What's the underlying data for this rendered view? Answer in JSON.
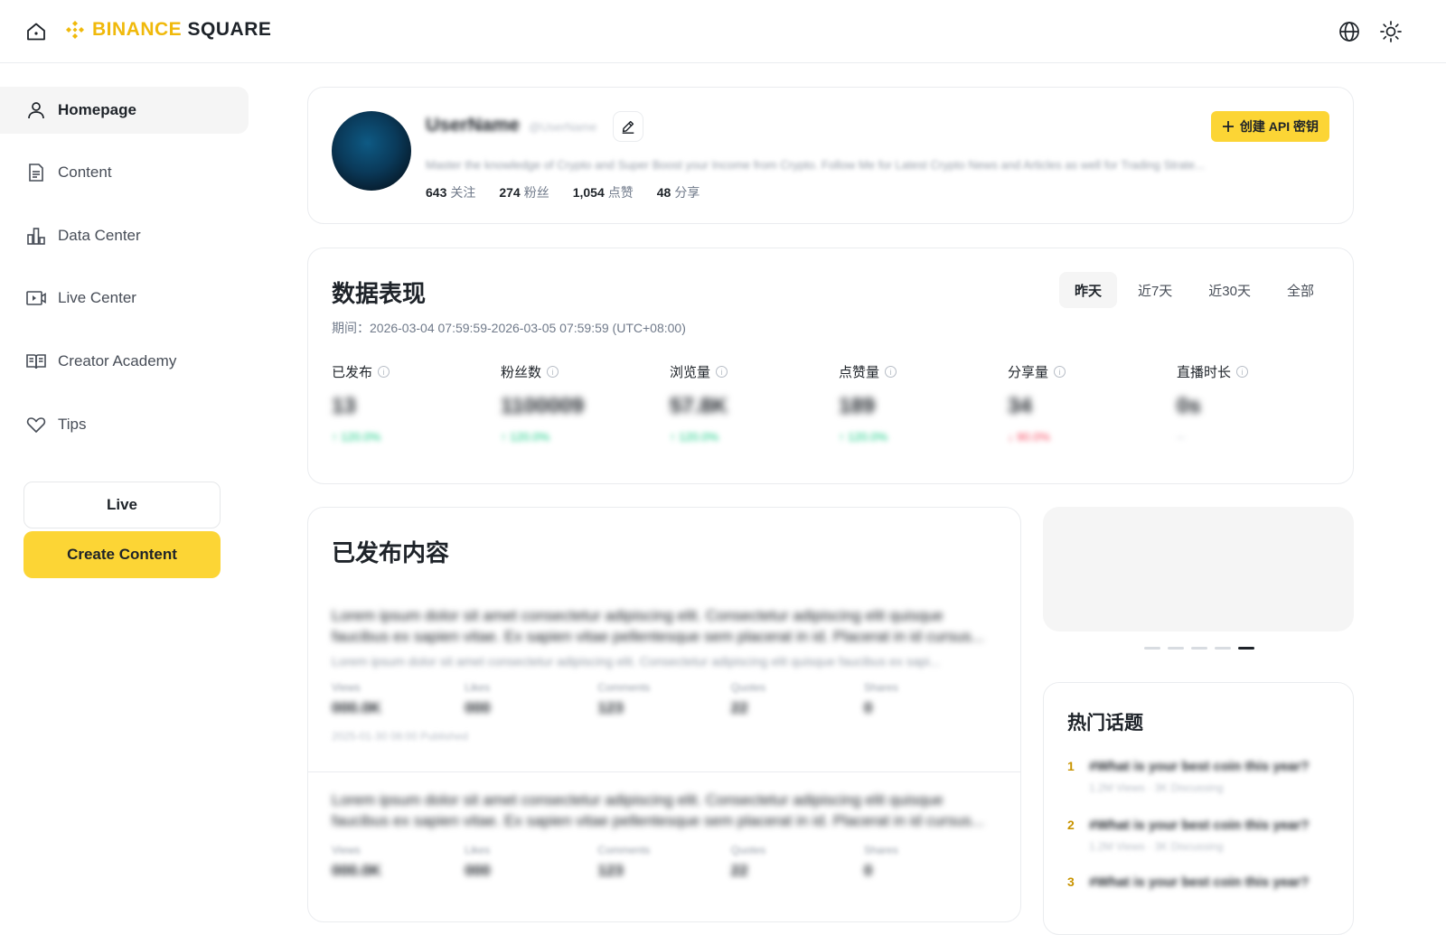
{
  "header": {
    "brand_part1": "BINANCE",
    "brand_part2": "SQUARE",
    "icons": [
      "home-icon",
      "globe-icon",
      "sun-icon"
    ],
    "brand_color": "#f0b90b"
  },
  "sidebar": {
    "items": [
      {
        "label": "Homepage",
        "icon": "user-icon",
        "active": true
      },
      {
        "label": "Content",
        "icon": "document-icon"
      },
      {
        "label": "Data Center",
        "icon": "bar-chart-icon"
      },
      {
        "label": "Live Center",
        "icon": "video-icon"
      },
      {
        "label": "Creator Academy",
        "icon": "book-icon"
      },
      {
        "label": "Tips",
        "icon": "heart-icon"
      }
    ],
    "live_label": "Live",
    "create_label": "Create Content"
  },
  "profile": {
    "username": "UserName",
    "handle": "@UserName",
    "bio": "Master the knowledge of Crypto and Super Boost your Income from Crypto. Follow Me for Latest Crypto News and Articles as well for Trading Strate...",
    "stats": [
      {
        "num": "643",
        "label": "关注"
      },
      {
        "num": "274",
        "label": "粉丝"
      },
      {
        "num": "1,054",
        "label": "点赞"
      },
      {
        "num": "48",
        "label": "分享"
      }
    ],
    "api_button": "创建 API 密钥"
  },
  "performance": {
    "title": "数据表现",
    "period": "期间：2026-03-04 07:59:59-2026-03-05 07:59:59 (UTC+08:00)",
    "tabs": [
      {
        "label": "昨天",
        "active": true
      },
      {
        "label": "近7天"
      },
      {
        "label": "近30天"
      },
      {
        "label": "全部"
      }
    ],
    "metrics": [
      {
        "label": "已发布",
        "value": "13",
        "change": "↑ 120.0%",
        "trend": "up"
      },
      {
        "label": "粉丝数",
        "value": "1100009",
        "change": "↑ 120.0%",
        "trend": "up"
      },
      {
        "label": "浏览量",
        "value": "57.8K",
        "change": "↑ 120.0%",
        "trend": "up"
      },
      {
        "label": "点赞量",
        "value": "189",
        "change": "↑ 120.0%",
        "trend": "up"
      },
      {
        "label": "分享量",
        "value": "34",
        "change": "↓ 90.0%",
        "trend": "down"
      },
      {
        "label": "直播时长",
        "value": "0s",
        "change": "--",
        "trend": "flat"
      }
    ]
  },
  "published": {
    "title": "已发布内容",
    "posts": [
      {
        "text": "Lorem ipsum dolor sit amet consectetur adipiscing elit. Consectetur adipiscing elit quisque faucibus ex sapien vitae. Ex sapien vitae pellentesque sem placerat in id. Placerat in id cursus...",
        "sub": "Lorem ipsum dolor sit amet consectetur adipiscing elit. Consectetur adipiscing elit quisque faucibus ex sapi...",
        "stats": [
          {
            "label": "Views",
            "value": "000.0K"
          },
          {
            "label": "Likes",
            "value": "000"
          },
          {
            "label": "Comments",
            "value": "123"
          },
          {
            "label": "Quotes",
            "value": "22"
          },
          {
            "label": "Shares",
            "value": "0"
          }
        ],
        "date": "2025-01-30 08:00 Published"
      },
      {
        "text": "Lorem ipsum dolor sit amet consectetur adipiscing elit. Consectetur adipiscing elit quisque faucibus ex sapien vitae. Ex sapien vitae pellentesque sem placerat in id. Placerat in id cursus...",
        "stats": [
          {
            "label": "Views",
            "value": "000.0K"
          },
          {
            "label": "Likes",
            "value": "000"
          },
          {
            "label": "Comments",
            "value": "123"
          },
          {
            "label": "Quotes",
            "value": "22"
          },
          {
            "label": "Shares",
            "value": "0"
          }
        ]
      }
    ]
  },
  "banner": {
    "dots_count": 5,
    "active_dot": 4
  },
  "trending": {
    "title": "热门话题",
    "items": [
      {
        "rank": "1",
        "title": "#What is your best coin this year?",
        "sub": "1.2M Views · 3K Discussing"
      },
      {
        "rank": "2",
        "title": "#What is your best coin this year?",
        "sub": "1.2M Views · 3K Discussing"
      },
      {
        "rank": "3",
        "title": "#What is your best coin this year?",
        "sub": ""
      }
    ]
  }
}
